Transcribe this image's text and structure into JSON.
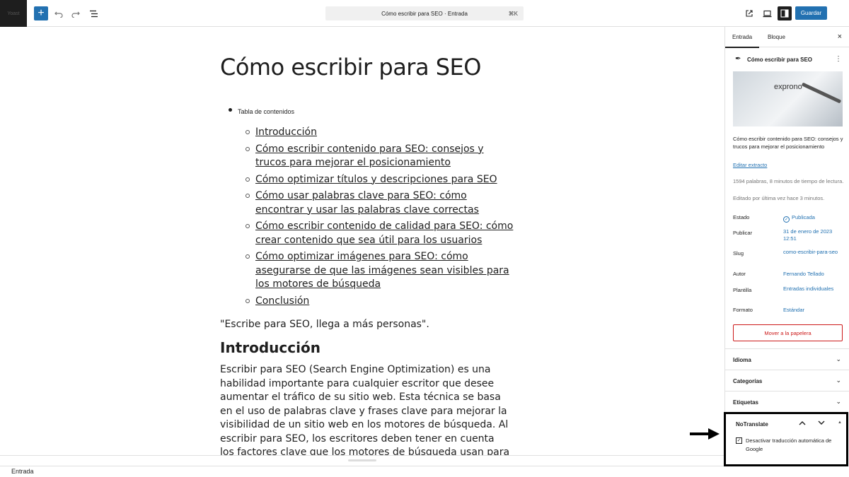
{
  "topbar": {
    "logo": "Yoast",
    "command": "Cómo escribir para SEO · Entrada",
    "shortcut": "⌘K",
    "save": "Guardar"
  },
  "editor": {
    "title": "Cómo escribir para SEO",
    "toc_heading": "Tabla de contenidos",
    "toc": [
      "Introducción",
      "Cómo escribir contenido para SEO: consejos y trucos para mejorar el posicionamiento",
      "Cómo optimizar títulos y descripciones para SEO",
      "Cómo usar palabras clave para SEO: cómo encontrar y usar las palabras clave correctas",
      "Cómo escribir contenido de calidad para SEO: cómo crear contenido que sea útil para los usuarios",
      "Cómo optimizar imágenes para SEO: cómo asegurarse de que las imágenes sean visibles para los motores de búsqueda",
      "Conclusión"
    ],
    "quote": "\"Escribe para SEO, llega a más personas\".",
    "h2": "Introducción",
    "paragraph": "Escribir para SEO (Search Engine Optimization) es una habilidad importante para cualquier escritor que desee aumentar el tráfico de su sitio web. Esta técnica se basa en el uso de palabras clave y frases clave para mejorar la visibilidad de un sitio web en los motores de búsqueda. Al escribir para SEO, los escritores deben tener en cuenta los factores clave que los motores de búsqueda usan para determinar la relevancia de un sitio web para una"
  },
  "statusbar": {
    "label": "Entrada"
  },
  "sidebar": {
    "tab_post": "Entrada",
    "tab_block": "Bloque",
    "close": "×",
    "summary_title": "Cómo escribir para SEO",
    "thumb_text": "exprono",
    "excerpt": "Cómo escribir contenido para SEO: consejos y trucos para mejorar el posicionamiento",
    "edit_excerpt": "Editar extracto",
    "stats": "1594 palabras, 8 minutos de tiempo de lectura.",
    "edited": "Editado por última vez hace 3 minutos.",
    "rows": [
      {
        "label": "Estado",
        "value": "Publicada"
      },
      {
        "label": "Publicar",
        "value": "31 de enero de 2023 12:51"
      },
      {
        "label": "Slug",
        "value": "como-escribir-para-seo"
      },
      {
        "label": "Autor",
        "value": "Fernando Tellado"
      },
      {
        "label": "Plantilla",
        "value": "Entradas individuales"
      },
      {
        "label": "Formato",
        "value": "Estándar"
      }
    ],
    "trash": "Mover a la papelera",
    "panels": [
      "Idioma",
      "Categorías",
      "Etiquetas"
    ],
    "notranslate": {
      "title": "NoTranslate",
      "checkbox": "Desactivar traducción automática de Google"
    }
  }
}
